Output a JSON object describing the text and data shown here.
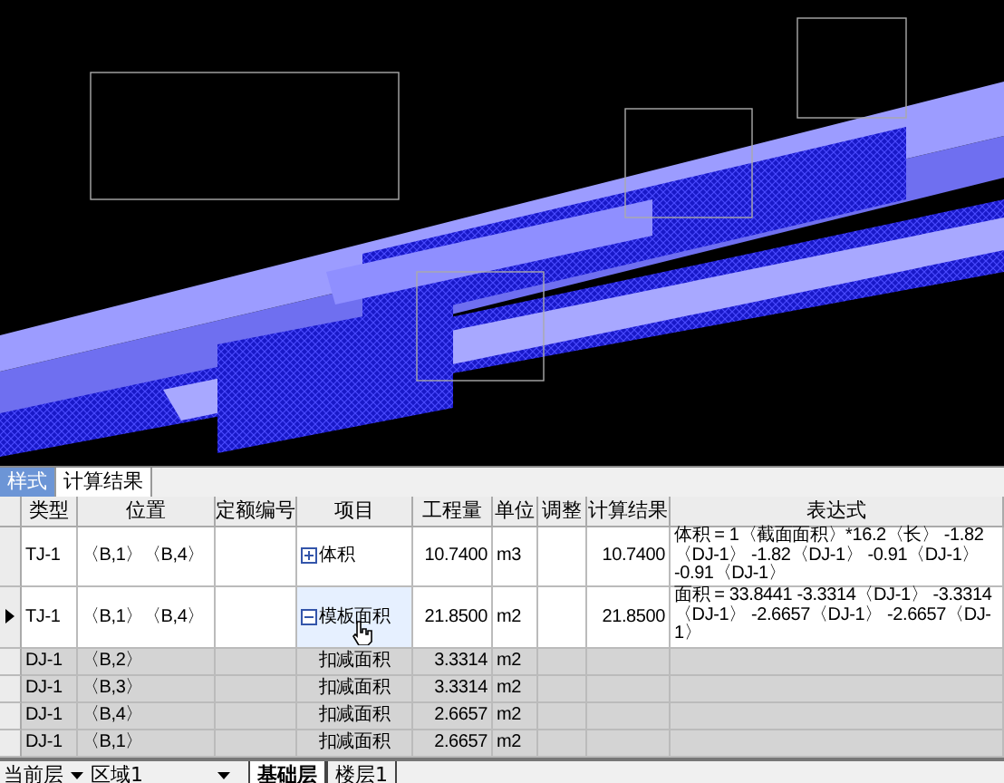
{
  "tabs": [
    {
      "label": "样式",
      "selected": false
    },
    {
      "label": "计算结果",
      "selected": true
    }
  ],
  "table": {
    "columns": [
      "类型",
      "位置",
      "定额编号",
      "项目",
      "工程量",
      "单位",
      "调整",
      "计算结果",
      "表达式"
    ],
    "rows": [
      {
        "current": false,
        "shaded": false,
        "expanded": false,
        "cells": [
          "TJ-1",
          "〈B,1〉〈B,4〉",
          "",
          "体积",
          "10.7400",
          "m3",
          "",
          "10.7400",
          "体积 = 1〈截面面积〉*16.2〈长〉 -1.82〈DJ-1〉 -1.82〈DJ-1〉 -0.91〈DJ-1〉 -0.91〈DJ-1〉"
        ]
      },
      {
        "current": true,
        "shaded": false,
        "expanded": true,
        "cells": [
          "TJ-1",
          "〈B,1〉〈B,4〉",
          "",
          "模板面积",
          "21.8500",
          "m2",
          "",
          "21.8500",
          "面积 = 33.8441 -3.3314〈DJ-1〉 -3.3314〈DJ-1〉 -2.6657〈DJ-1〉 -2.6657〈DJ-1〉"
        ]
      },
      {
        "current": false,
        "shaded": true,
        "cells": [
          "DJ-1",
          "〈B,2〉",
          "",
          "扣减面积",
          "3.3314",
          "m2",
          "",
          "",
          ""
        ]
      },
      {
        "current": false,
        "shaded": true,
        "cells": [
          "DJ-1",
          "〈B,3〉",
          "",
          "扣减面积",
          "3.3314",
          "m2",
          "",
          "",
          ""
        ]
      },
      {
        "current": false,
        "shaded": true,
        "cells": [
          "DJ-1",
          "〈B,4〉",
          "",
          "扣减面积",
          "2.6657",
          "m2",
          "",
          "",
          ""
        ]
      },
      {
        "current": false,
        "shaded": true,
        "cells": [
          "DJ-1",
          "〈B,1〉",
          "",
          "扣减面积",
          "2.6657",
          "m2",
          "",
          "",
          ""
        ]
      }
    ]
  },
  "status_bar": {
    "label": "当前层",
    "area": "区域1",
    "floor_tabs": [
      {
        "label": "基础层",
        "selected": true
      },
      {
        "label": "楼层1",
        "selected": false
      }
    ]
  }
}
